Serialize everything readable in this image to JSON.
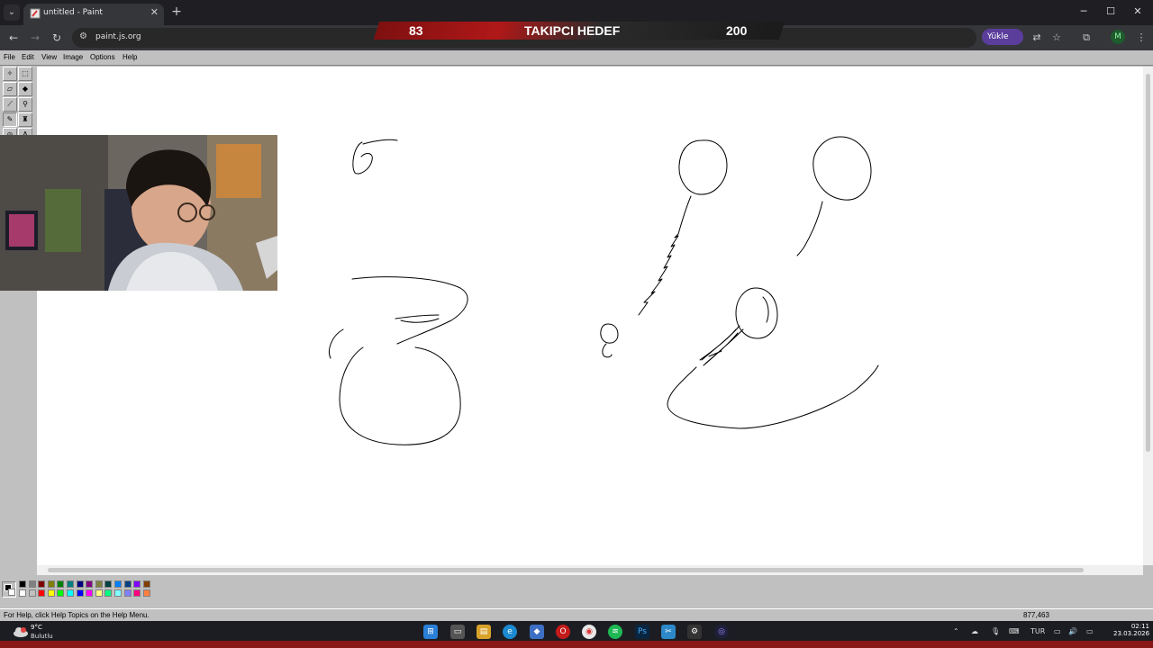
{
  "browser": {
    "tab_title": "untitled - Paint",
    "tab_close": "✕",
    "new_tab": "+",
    "url": "paint.js.org",
    "yukle_label": "Yükle",
    "profile_initial": "M",
    "window_min": "─",
    "window_max": "☐",
    "window_close": "✕"
  },
  "overlay": {
    "current": "83",
    "label": "TAKIPCI HEDEF",
    "goal": "200"
  },
  "paint": {
    "menu": [
      "File",
      "Edit",
      "View",
      "Image",
      "Options",
      "Help"
    ],
    "status_help": "For Help, click Help Topics on the Help Menu.",
    "status_coords": "877,463",
    "colors": {
      "foreground": "#000000",
      "background": "#ffffff"
    },
    "palette_top": [
      "#000000",
      "#808080",
      "#800000",
      "#808000",
      "#008000",
      "#008080",
      "#000080",
      "#800080",
      "#808040",
      "#004040",
      "#0080ff",
      "#004080",
      "#8000ff",
      "#804000"
    ],
    "palette_bottom": [
      "#ffffff",
      "#c0c0c0",
      "#ff0000",
      "#ffff00",
      "#00ff00",
      "#00ffff",
      "#0000ff",
      "#ff00ff",
      "#ffff80",
      "#00ff80",
      "#80ffff",
      "#8080ff",
      "#ff0080",
      "#ff8040"
    ]
  },
  "taskbar": {
    "weather_temp": "9°C",
    "weather_cond": "Bulutlu",
    "lang": "TUR",
    "time": "02:11",
    "date": "23.03.2026"
  }
}
